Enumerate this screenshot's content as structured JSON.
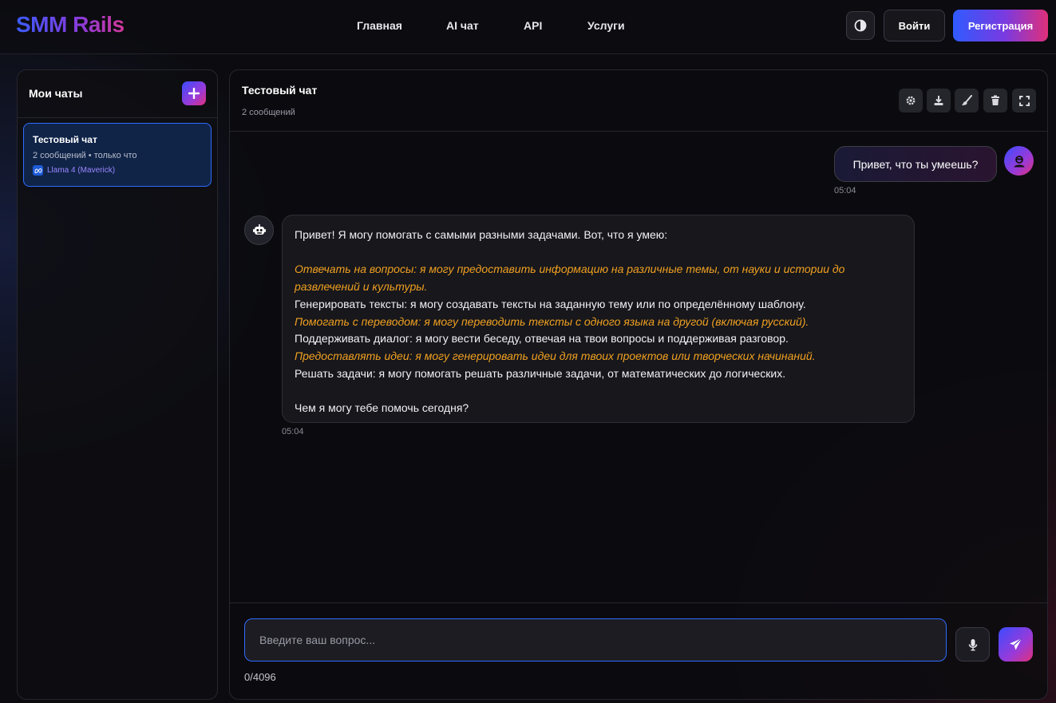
{
  "header": {
    "logo": "SMM Rails",
    "nav": [
      "Главная",
      "AI чат",
      "API",
      "Услуги"
    ],
    "login": "Войти",
    "register": "Регистрация"
  },
  "sidebar": {
    "title": "Мои чаты",
    "chats": [
      {
        "title": "Тестовый чат",
        "meta": "2 сообщений • только что",
        "model": "Llama 4 (Maverick)"
      }
    ]
  },
  "chat": {
    "title": "Тестовый чат",
    "count": "2 сообщений",
    "tools": [
      "gear-icon",
      "download-icon",
      "brush-icon",
      "trash-icon",
      "fullscreen-icon"
    ],
    "messages": {
      "user": {
        "text": "Привет, что ты умеешь?",
        "time": "05:04"
      },
      "bot": {
        "lines": [
          "Привет! Я могу помогать с самыми разными задачами. Вот, что я умею:",
          "",
          "Отвечать на вопросы: я могу предоставить информацию на различные темы, от науки и истории до",
          "развлечений и культуры.",
          "Генерировать тексты: я могу создавать тексты на заданную тему или по определённому шаблону.",
          "Помогать с переводом: я могу переводить тексты с одного языка на другой (включая русский).",
          "Поддерживать диалог: я могу вести беседу, отвечая на твои вопросы и поддерживая разговор.",
          "Предоставлять идеи: я могу генерировать идеи для твоих проектов или творческих начинаний.",
          "Решать задачи: я могу помогать решать различные задачи, от математических до логических.",
          "",
          "Чем я могу тебе помочь сегодня?"
        ],
        "time": "05:04"
      }
    }
  },
  "composer": {
    "placeholder": "Введите ваш вопрос...",
    "value": "",
    "counter": "0/4096"
  },
  "colors": {
    "accent_blue": "#2f6cff",
    "accent_orange": "#f0a020",
    "gradient_start": "#3a4cff",
    "gradient_end": "#e0307a"
  }
}
